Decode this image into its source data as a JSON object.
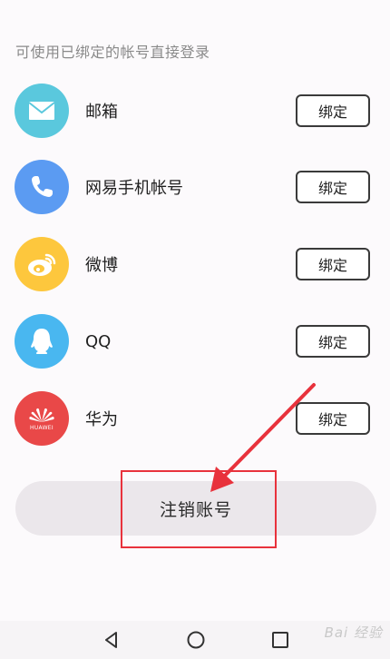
{
  "hint": "可使用已绑定的帐号直接登录",
  "accounts": [
    {
      "label": "邮箱",
      "icon": "mail-icon",
      "color": "#5ac8dd",
      "button": "绑定"
    },
    {
      "label": "网易手机帐号",
      "icon": "phone-icon",
      "color": "#5b9bf2",
      "button": "绑定"
    },
    {
      "label": "微博",
      "icon": "weibo-icon",
      "color": "#fdc73d",
      "button": "绑定"
    },
    {
      "label": "QQ",
      "icon": "qq-icon",
      "color": "#49b7f0",
      "button": "绑定"
    },
    {
      "label": "华为",
      "icon": "huawei-icon",
      "color": "#e94848",
      "button": "绑定"
    }
  ],
  "huawei_logo_text": "HUAWEI",
  "logout": "注销账号",
  "annotation_color": "#e8323c",
  "navbar": [
    "back-icon",
    "home-icon",
    "recents-icon"
  ],
  "watermark": "Bai 经验"
}
